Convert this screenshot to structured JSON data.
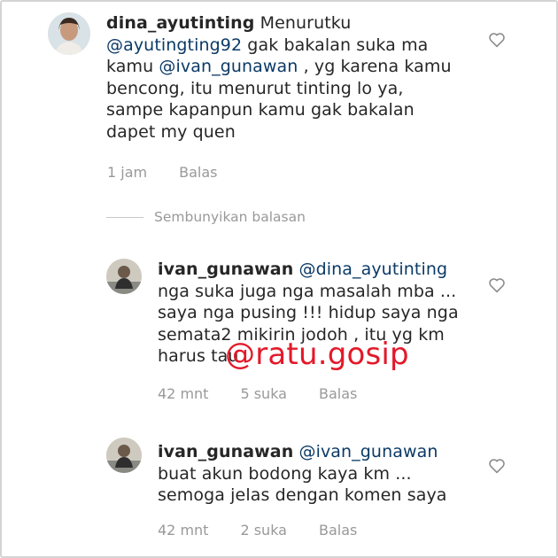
{
  "comments": [
    {
      "username": "dina_ayutinting",
      "lines": [
        [
          "Menurutku"
        ],
        [
          "@ayutingting92",
          " gak bakalan suka ma"
        ],
        [
          "kamu ",
          "@ivan_gunawan",
          " , yg karena kamu"
        ],
        [
          "bencong, itu menurut tinting lo ya,"
        ],
        [
          "sampe kapanpun kamu gak bakalan"
        ],
        [
          "dapet my quen"
        ]
      ],
      "time": "1 jam",
      "reply_label": "Balas"
    },
    {
      "username": "ivan_gunawan",
      "mention": "@dina_ayutinting",
      "lines": [
        "nga suka juga nga masalah mba ...",
        "saya nga pusing !!! hidup saya nga",
        "semata2 mikirin jodoh , itu yg km",
        "harus tau"
      ],
      "time": "42 mnt",
      "likes": "5 suka",
      "reply_label": "Balas"
    },
    {
      "username": "ivan_gunawan",
      "mention": "@ivan_gunawan",
      "lines": [
        "buat akun bodong kaya km ...",
        "semoga jelas dengan komen saya"
      ],
      "time": "42 mnt",
      "likes": "2 suka",
      "reply_label": "Balas"
    }
  ],
  "hide_replies_label": "Sembunyikan balasan",
  "watermark": "@ratu.gosip",
  "colors": {
    "mention": "#0b3a66",
    "meta": "#999999",
    "watermark": "#e3192a"
  },
  "icons": {
    "like": "heart-outline-icon"
  }
}
